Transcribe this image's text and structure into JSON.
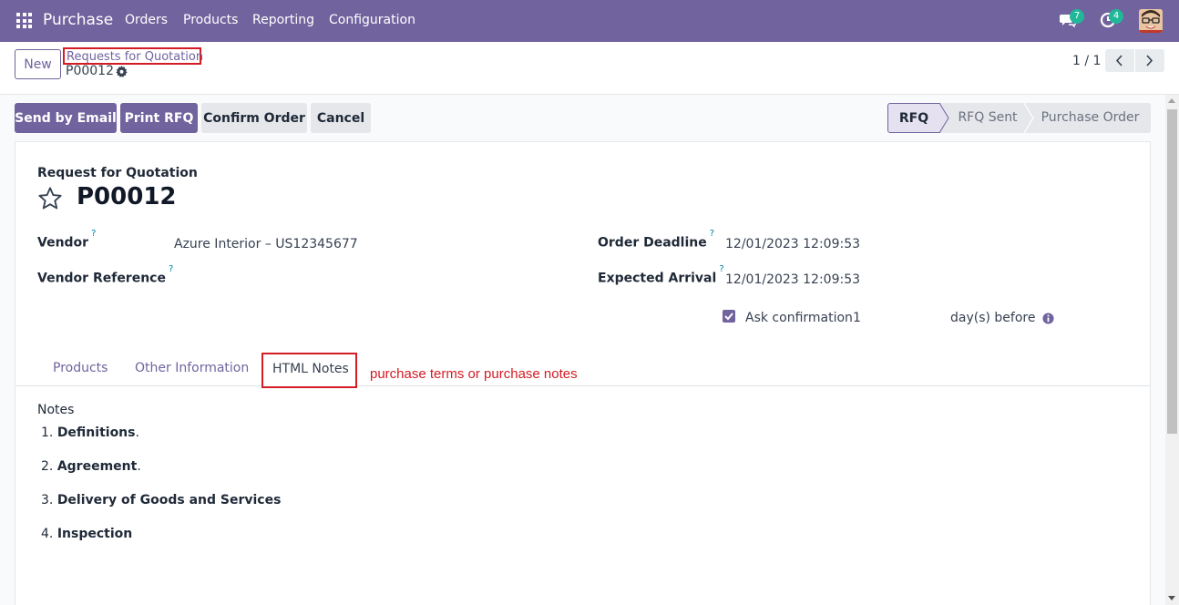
{
  "navbar": {
    "app_name": "Purchase",
    "menu": [
      "Orders",
      "Products",
      "Reporting",
      "Configuration"
    ],
    "chat_count": "7",
    "activity_count": "4"
  },
  "control": {
    "new_label": "New",
    "breadcrumb": "Requests for Quotation",
    "record": "P00012",
    "pager": "1 / 1"
  },
  "actions": {
    "send_email": "Send by Email",
    "print_rfq": "Print RFQ",
    "confirm_order": "Confirm Order",
    "cancel": "Cancel"
  },
  "status": {
    "stages": [
      "RFQ",
      "RFQ Sent",
      "Purchase Order"
    ],
    "active": "RFQ"
  },
  "form": {
    "subtitle": "Request for Quotation",
    "title": "P00012",
    "vendor_label": "Vendor",
    "vendor_value": "Azure Interior – US12345677",
    "vendor_ref_label": "Vendor Reference",
    "vendor_ref_value": "",
    "deadline_label": "Order Deadline",
    "deadline_value": "12/01/2023 12:09:53",
    "arrival_label": "Expected Arrival",
    "arrival_value": "12/01/2023 12:09:53",
    "ask_confirmation_label": "Ask confirmation",
    "ask_confirmation_days": "1",
    "days_before_label": "day(s) before",
    "help_mark": "?"
  },
  "tabs": {
    "items": [
      "Products",
      "Other Information",
      "HTML Notes"
    ],
    "active": "HTML Notes",
    "annotation": "purchase terms or purchase notes"
  },
  "notes": {
    "label": "Notes",
    "items": [
      {
        "num": "1.",
        "bold": "Definitions",
        "suffix": "."
      },
      {
        "num": "2.",
        "bold": "Agreement",
        "suffix": "."
      },
      {
        "num": "3.",
        "bold": "Delivery of Goods and Services",
        "suffix": ""
      },
      {
        "num": "4.",
        "bold": "Inspection",
        "suffix": ""
      }
    ]
  },
  "colors": {
    "brand": "#71639e",
    "highlight": "#d41c24",
    "badge": "#21b799"
  }
}
